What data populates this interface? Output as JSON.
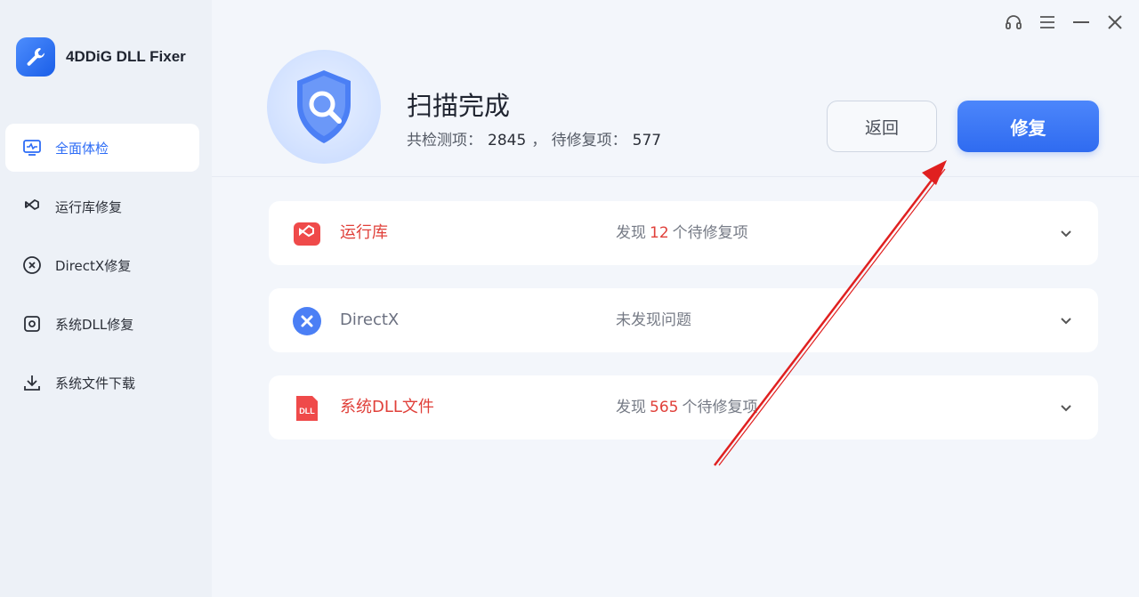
{
  "app": {
    "name": "4DDiG DLL Fixer"
  },
  "sidebar": {
    "items": [
      {
        "label": "全面体检",
        "icon": "monitor-pulse-icon",
        "active": true
      },
      {
        "label": "运行库修复",
        "icon": "visual-studio-icon",
        "active": false
      },
      {
        "label": "DirectX修复",
        "icon": "directx-icon",
        "active": false
      },
      {
        "label": "系统DLL修复",
        "icon": "gear-icon",
        "active": false
      },
      {
        "label": "系统文件下载",
        "icon": "download-icon",
        "active": false
      }
    ]
  },
  "window_controls": {
    "icons": [
      "headset-icon",
      "menu-icon",
      "minimize-icon",
      "close-icon"
    ]
  },
  "scan": {
    "title": "扫描完成",
    "checked_label": "共检测项：",
    "checked_value": "2845",
    "separator": "，",
    "pending_label": "待修复项：",
    "pending_value": "577",
    "back_label": "返回",
    "fix_label": "修复"
  },
  "results": [
    {
      "title": "运行库",
      "icon": "visual-studio-icon",
      "status_prefix": "发现",
      "count": "12",
      "status_suffix": "个待修复项",
      "has_issues": true
    },
    {
      "title": "DirectX",
      "icon": "directx-icon",
      "status_text": "未发现问题",
      "has_issues": false
    },
    {
      "title": "系统DLL文件",
      "icon": "dll-file-icon",
      "status_prefix": "发现",
      "count": "565",
      "status_suffix": "个待修复项",
      "has_issues": true
    }
  ],
  "colors": {
    "accent": "#2f6bf0",
    "issue": "#e0403a",
    "annotation_arrow": "#e02020"
  }
}
